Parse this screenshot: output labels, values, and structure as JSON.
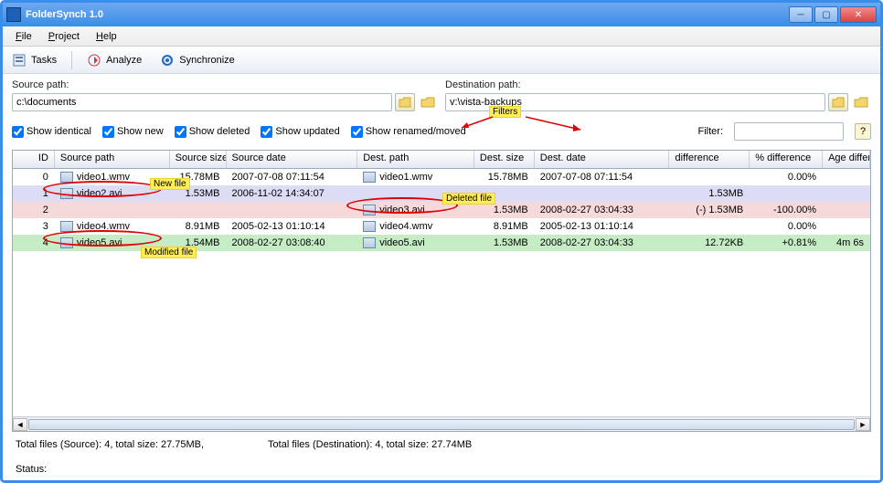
{
  "window": {
    "title": "FolderSynch 1.0"
  },
  "menu": {
    "file": "File",
    "project": "Project",
    "help": "Help",
    "file_u": "F",
    "project_u": "P",
    "help_u": "H"
  },
  "toolbar": {
    "tasks": "Tasks",
    "analyze": "Analyze",
    "sync": "Synchronize"
  },
  "paths": {
    "src_label": "Source path:",
    "src_value": "c:\\documents",
    "dst_label": "Destination path:",
    "dst_value": "v:\\vista-backups"
  },
  "filters": {
    "identical": "Show identical",
    "new": "Show new",
    "deleted": "Show deleted",
    "updated": "Show updated",
    "renamed": "Show renamed/moved",
    "label": "Filter:",
    "value": "",
    "ann": "Filters"
  },
  "grid": {
    "headers": {
      "id": "ID",
      "sp": "Source path",
      "ss": "Source size",
      "sd": "Source date",
      "dp": "Dest. path",
      "ds": "Dest. size",
      "dd": "Dest. date",
      "df": "difference",
      "pd": "% difference",
      "ad": "Age differe..."
    },
    "rows": [
      {
        "id": "0",
        "sp": "video1.wmv",
        "ss": "15.78MB",
        "sd": "2007-07-08 07:11:54",
        "dp": "video1.wmv",
        "ds": "15.78MB",
        "dd": "2007-07-08 07:11:54",
        "df": "",
        "pd": "0.00%",
        "ad": "",
        "cls": ""
      },
      {
        "id": "1",
        "sp": "video2.avi",
        "ss": "1.53MB",
        "sd": "2006-11-02 14:34:07",
        "dp": "",
        "ds": "",
        "dd": "",
        "df": "1.53MB",
        "pd": "",
        "ad": "",
        "cls": "row-newfile"
      },
      {
        "id": "2",
        "sp": "",
        "ss": "",
        "sd": "",
        "dp": "video3.avi",
        "ds": "1.53MB",
        "dd": "2008-02-27 03:04:33",
        "df": "(-) 1.53MB",
        "pd": "-100.00%",
        "ad": "",
        "cls": "row-delfile"
      },
      {
        "id": "3",
        "sp": "video4.wmv",
        "ss": "8.91MB",
        "sd": "2005-02-13 01:10:14",
        "dp": "video4.wmv",
        "ds": "8.91MB",
        "dd": "2005-02-13 01:10:14",
        "df": "",
        "pd": "0.00%",
        "ad": "",
        "cls": ""
      },
      {
        "id": "4",
        "sp": "video5.avi",
        "ss": "1.54MB",
        "sd": "2008-02-27 03:08:40",
        "dp": "video5.avi",
        "ds": "1.53MB",
        "dd": "2008-02-27 03:04:33",
        "df": "12.72KB",
        "pd": "+0.81%",
        "ad": "4m 6s",
        "cls": "row-modfile"
      }
    ]
  },
  "footer": {
    "src": "Total files (Source): 4, total size: 27.75MB,",
    "dst": "Total files (Destination): 4, total size: 27.74MB"
  },
  "status": {
    "label": "Status:"
  },
  "ann": {
    "newfile": "New file",
    "delfile": "Deleted file",
    "modfile": "Modified file"
  }
}
